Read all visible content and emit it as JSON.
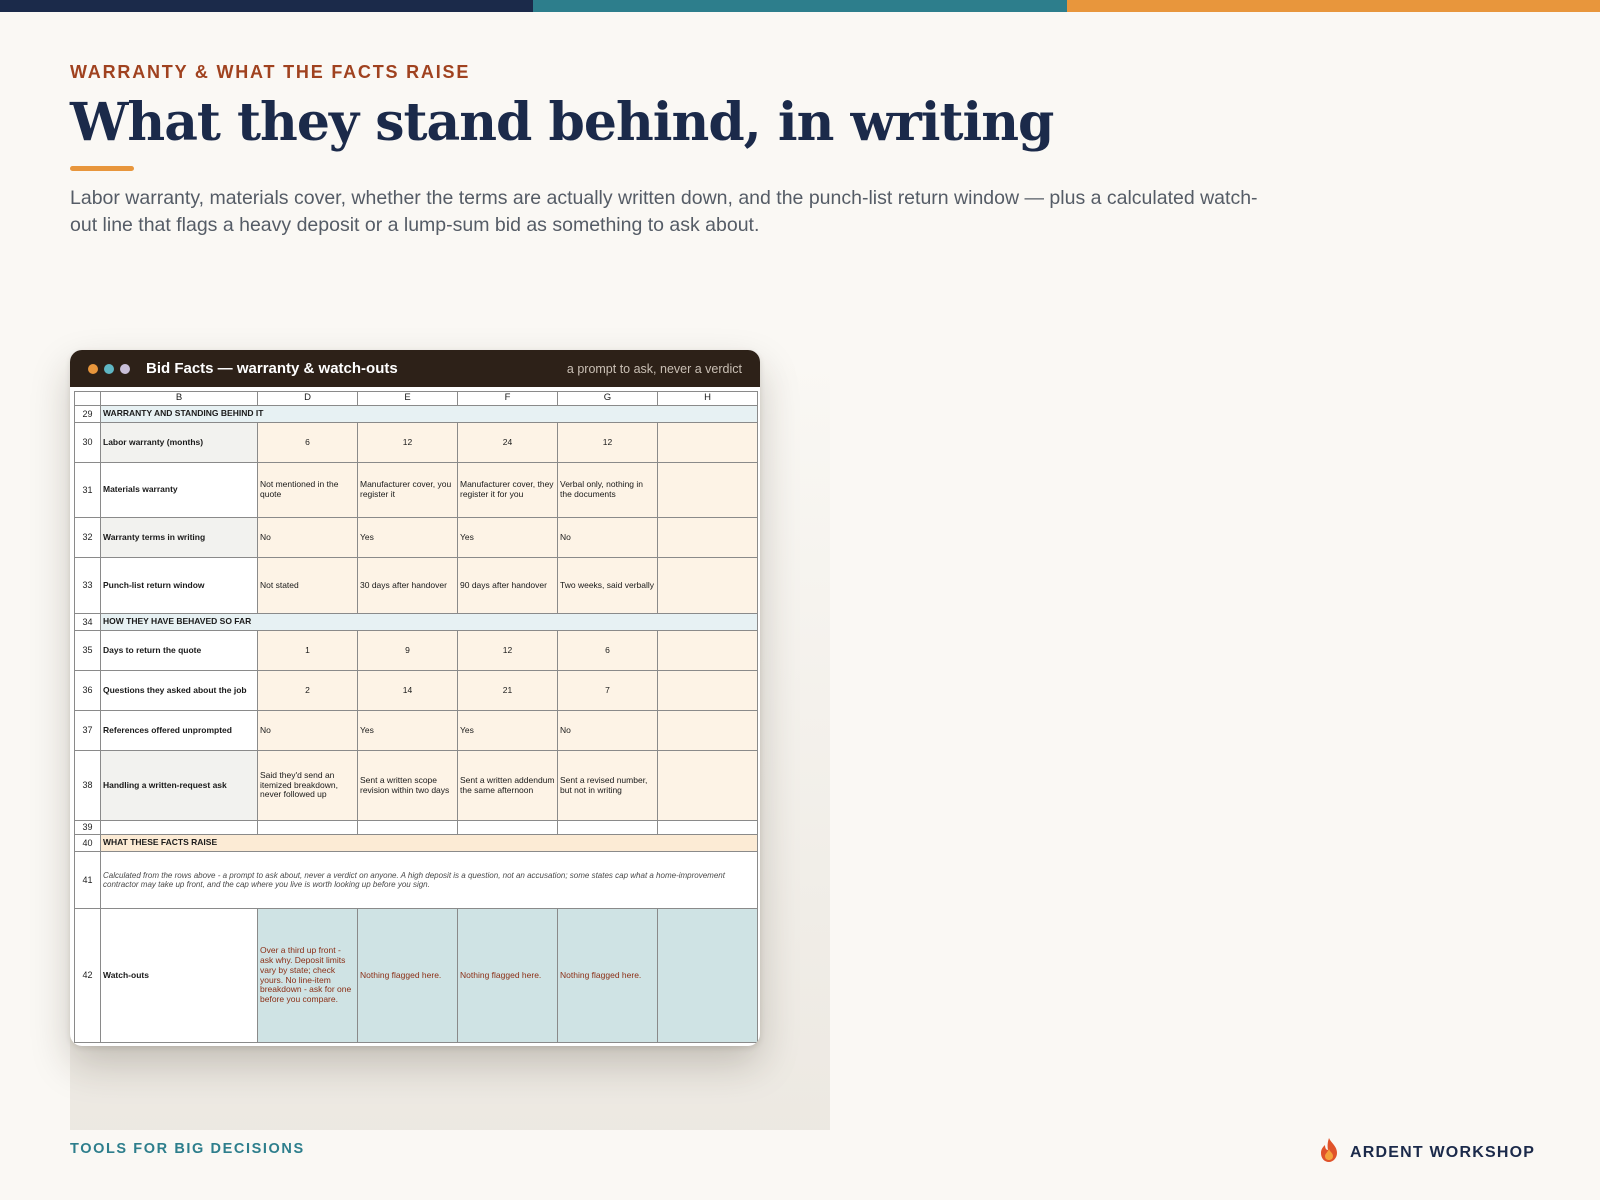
{
  "palette": {
    "navy": "#1b2a4a",
    "teal": "#2d7e8c",
    "orange": "#e8963c",
    "rust": "#a0421f"
  },
  "header": {
    "eyebrow": "WARRANTY & WHAT THE FACTS RAISE",
    "title": "What they stand behind, in writing",
    "subtitle": "Labor warranty, materials cover, whether the terms are actually written down, and the punch-list return window — plus a calculated watch-out line that flags a heavy deposit or a lump-sum bid as something to ask about."
  },
  "window": {
    "title": "Bid Facts — warranty & watch-outs",
    "tagline": "a prompt to ask, never a verdict",
    "dots": [
      "#e8963c",
      "#5fb7c4",
      "#c9bfd8"
    ]
  },
  "sheet": {
    "columns": [
      "B",
      "D",
      "E",
      "F",
      "G",
      "H"
    ],
    "rows": {
      "r29": {
        "num": "29",
        "label": "WARRANTY AND STANDING BEHIND IT"
      },
      "r30": {
        "num": "30",
        "label": "Labor warranty (months)",
        "D": "6",
        "E": "12",
        "F": "24",
        "G": "12"
      },
      "r31": {
        "num": "31",
        "label": "Materials warranty",
        "D": "Not mentioned in the quote",
        "E": "Manufacturer cover, you register it",
        "F": "Manufacturer cover, they register it for you",
        "G": "Verbal only, nothing in the documents"
      },
      "r32": {
        "num": "32",
        "label": "Warranty terms in writing",
        "D": "No",
        "E": "Yes",
        "F": "Yes",
        "G": "No"
      },
      "r33": {
        "num": "33",
        "label": "Punch-list return window",
        "D": "Not stated",
        "E": "30 days after handover",
        "F": "90 days after handover",
        "G": "Two weeks, said verbally"
      },
      "r34": {
        "num": "34",
        "label": "HOW THEY HAVE BEHAVED SO FAR"
      },
      "r35": {
        "num": "35",
        "label": "Days to return the quote",
        "D": "1",
        "E": "9",
        "F": "12",
        "G": "6"
      },
      "r36": {
        "num": "36",
        "label": "Questions they asked about the job",
        "D": "2",
        "E": "14",
        "F": "21",
        "G": "7"
      },
      "r37": {
        "num": "37",
        "label": "References offered unprompted",
        "D": "No",
        "E": "Yes",
        "F": "Yes",
        "G": "No"
      },
      "r38": {
        "num": "38",
        "label": "Handling a written-request ask",
        "D": "Said they'd send an itemized breakdown, never followed up",
        "E": "Sent a written scope revision within two days",
        "F": "Sent a written addendum the same afternoon",
        "G": "Sent a revised number, but not in writing"
      },
      "r39": {
        "num": "39"
      },
      "r40": {
        "num": "40",
        "label": "WHAT THESE FACTS RAISE"
      },
      "r41": {
        "num": "41",
        "note": "Calculated from the rows above - a prompt to ask about, never a verdict on anyone. A high deposit is a question, not an accusation; some states cap what a home-improvement contractor may take up front, and the cap where you live is worth looking up before you sign."
      },
      "r42": {
        "num": "42",
        "label": "Watch-outs",
        "D": "Over a third up front - ask why. Deposit limits vary by state; check yours. No line-item breakdown - ask for one before you compare.",
        "E": "Nothing flagged here.",
        "F": "Nothing flagged here.",
        "G": "Nothing flagged here."
      }
    }
  },
  "footer": {
    "left": "TOOLS FOR BIG DECISIONS",
    "brand": "ARDENT WORKSHOP",
    "brand_icon": "flame-icon"
  }
}
